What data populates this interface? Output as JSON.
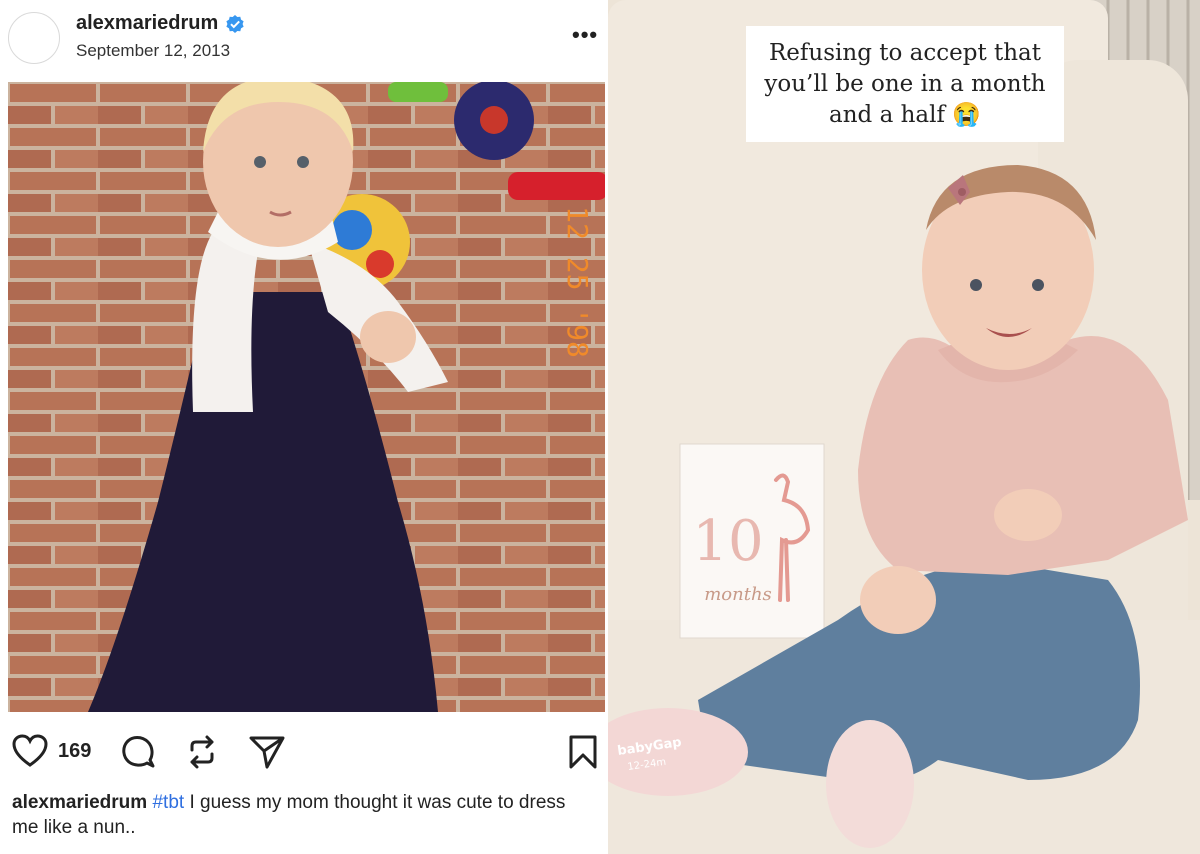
{
  "post": {
    "username": "alexmariedrum",
    "date": "September 12, 2013",
    "likes": "169",
    "caption_user": "alexmariedrum",
    "caption_tag": "#tbt",
    "caption_text": " I guess my mom thought it was cute to dress me like a nun..",
    "photo_stamp": "12 25 '98",
    "icons": [
      "verified-badge-icon",
      "more-options-icon",
      "heart-icon",
      "comment-icon",
      "repost-icon",
      "share-icon",
      "bookmark-icon"
    ]
  },
  "story": {
    "overlay_lines": [
      "Refusing to accept that",
      "you’ll be one in a month",
      "and a half 😭"
    ],
    "card_number": "10",
    "card_word": "months",
    "sock_brand": "babyGap",
    "sock_size": "12-24m"
  },
  "colors": {
    "verified": "#3797f0",
    "hashtag": "#2f6fe0",
    "dress": "#201a38",
    "shirt": "#e8bfb5",
    "jeans": "#5f7f9e"
  }
}
